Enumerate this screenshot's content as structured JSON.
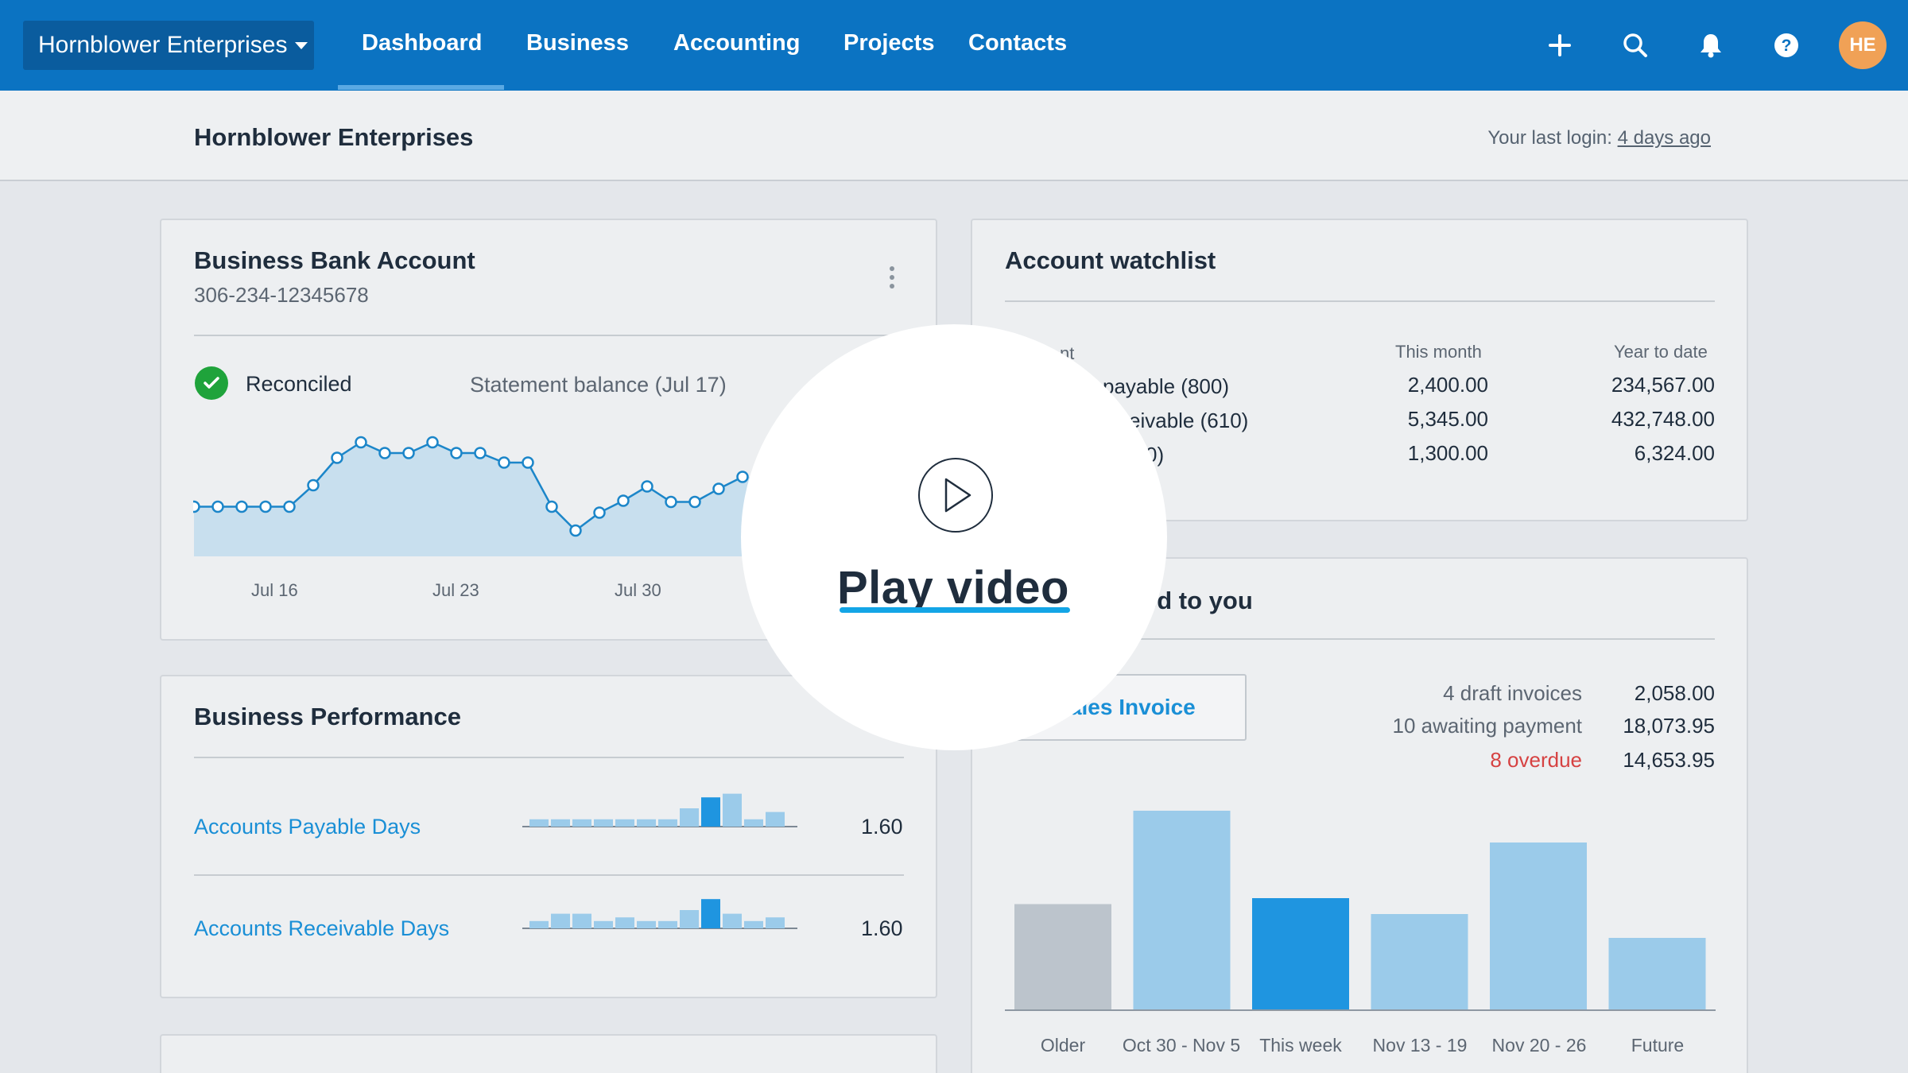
{
  "nav": {
    "org_name": "Hornblower Enterprises",
    "items": [
      "Dashboard",
      "Business",
      "Accounting",
      "Projects",
      "Contacts"
    ],
    "active": "Dashboard",
    "icons": [
      "plus-icon",
      "search-icon",
      "bell-icon",
      "help-icon"
    ],
    "avatar_initials": "HE"
  },
  "subheader": {
    "title": "Hornblower Enterprises",
    "last_login_prefix": "Your last login: ",
    "last_login_link": "4 days ago"
  },
  "bank": {
    "title": "Business Bank Account",
    "account_number": "306-234-12345678",
    "status": "Reconciled",
    "statement_label": "Statement balance (Jul 17)",
    "x_labels": [
      "Jul 16",
      "Jul 23",
      "Jul 30"
    ],
    "line_values": [
      0.5,
      0.5,
      0.5,
      0.5,
      0.5,
      2.3,
      4.6,
      5.9,
      5.0,
      5.0,
      5.9,
      5.0,
      5.0,
      4.2,
      4.2,
      0.5,
      -1.5,
      0.0,
      1.0,
      2.2,
      0.9,
      0.9,
      2.0,
      3.0
    ]
  },
  "watchlist": {
    "title": "Account watchlist",
    "col_month": "This month",
    "col_ytd": "Year to date",
    "account_header_fragment": "nt",
    "rows": [
      {
        "name_fragment": "payable (800)",
        "month": "2,400.00",
        "ytd": "234,567.00"
      },
      {
        "name_fragment": "eivable (610)",
        "month": "5,345.00",
        "ytd": "432,748.00"
      },
      {
        "name_fragment": "0)",
        "month": "1,300.00",
        "ytd": "6,324.00"
      }
    ]
  },
  "owed": {
    "title_fragment": "ed to you",
    "button_label": "Sales Invoice",
    "summary": [
      {
        "label": "4 draft invoices",
        "value": "2,058.00",
        "status": "normal"
      },
      {
        "label": "10 awaiting payment",
        "value": "18,073.95",
        "status": "normal"
      },
      {
        "label": "8 overdue",
        "value": "14,653.95",
        "status": "overdue"
      }
    ],
    "colors": {
      "older": "#bcc4cc",
      "normal": "#9bcbea",
      "current": "#1f95e0",
      "overdue_text": "#d64242"
    }
  },
  "chart_data": {
    "type": "bar",
    "categories": [
      "Older",
      "Oct 30 - Nov 5",
      "This week",
      "Nov 13 - 19",
      "Nov 20 - 26",
      "Future"
    ],
    "values": [
      53,
      100,
      56,
      48,
      84,
      36
    ],
    "ylim": [
      0,
      100
    ],
    "highlight": "This week",
    "grid": false,
    "title": "",
    "xlabel": "",
    "ylabel": ""
  },
  "performance": {
    "title": "Business Performance",
    "metrics": [
      {
        "label": "Accounts Payable Days",
        "value": "1.60",
        "sparkbars": [
          2,
          2,
          2,
          2,
          2,
          2,
          2,
          5,
          8,
          9,
          2,
          4
        ],
        "highlight_index": 8
      },
      {
        "label": "Accounts Receivable Days",
        "value": "1.60",
        "sparkbars": [
          2,
          4,
          4,
          2,
          3,
          2,
          2,
          5,
          8,
          4,
          2,
          3
        ],
        "highlight_index": 8
      }
    ]
  },
  "overlay": {
    "label": "Play video"
  }
}
